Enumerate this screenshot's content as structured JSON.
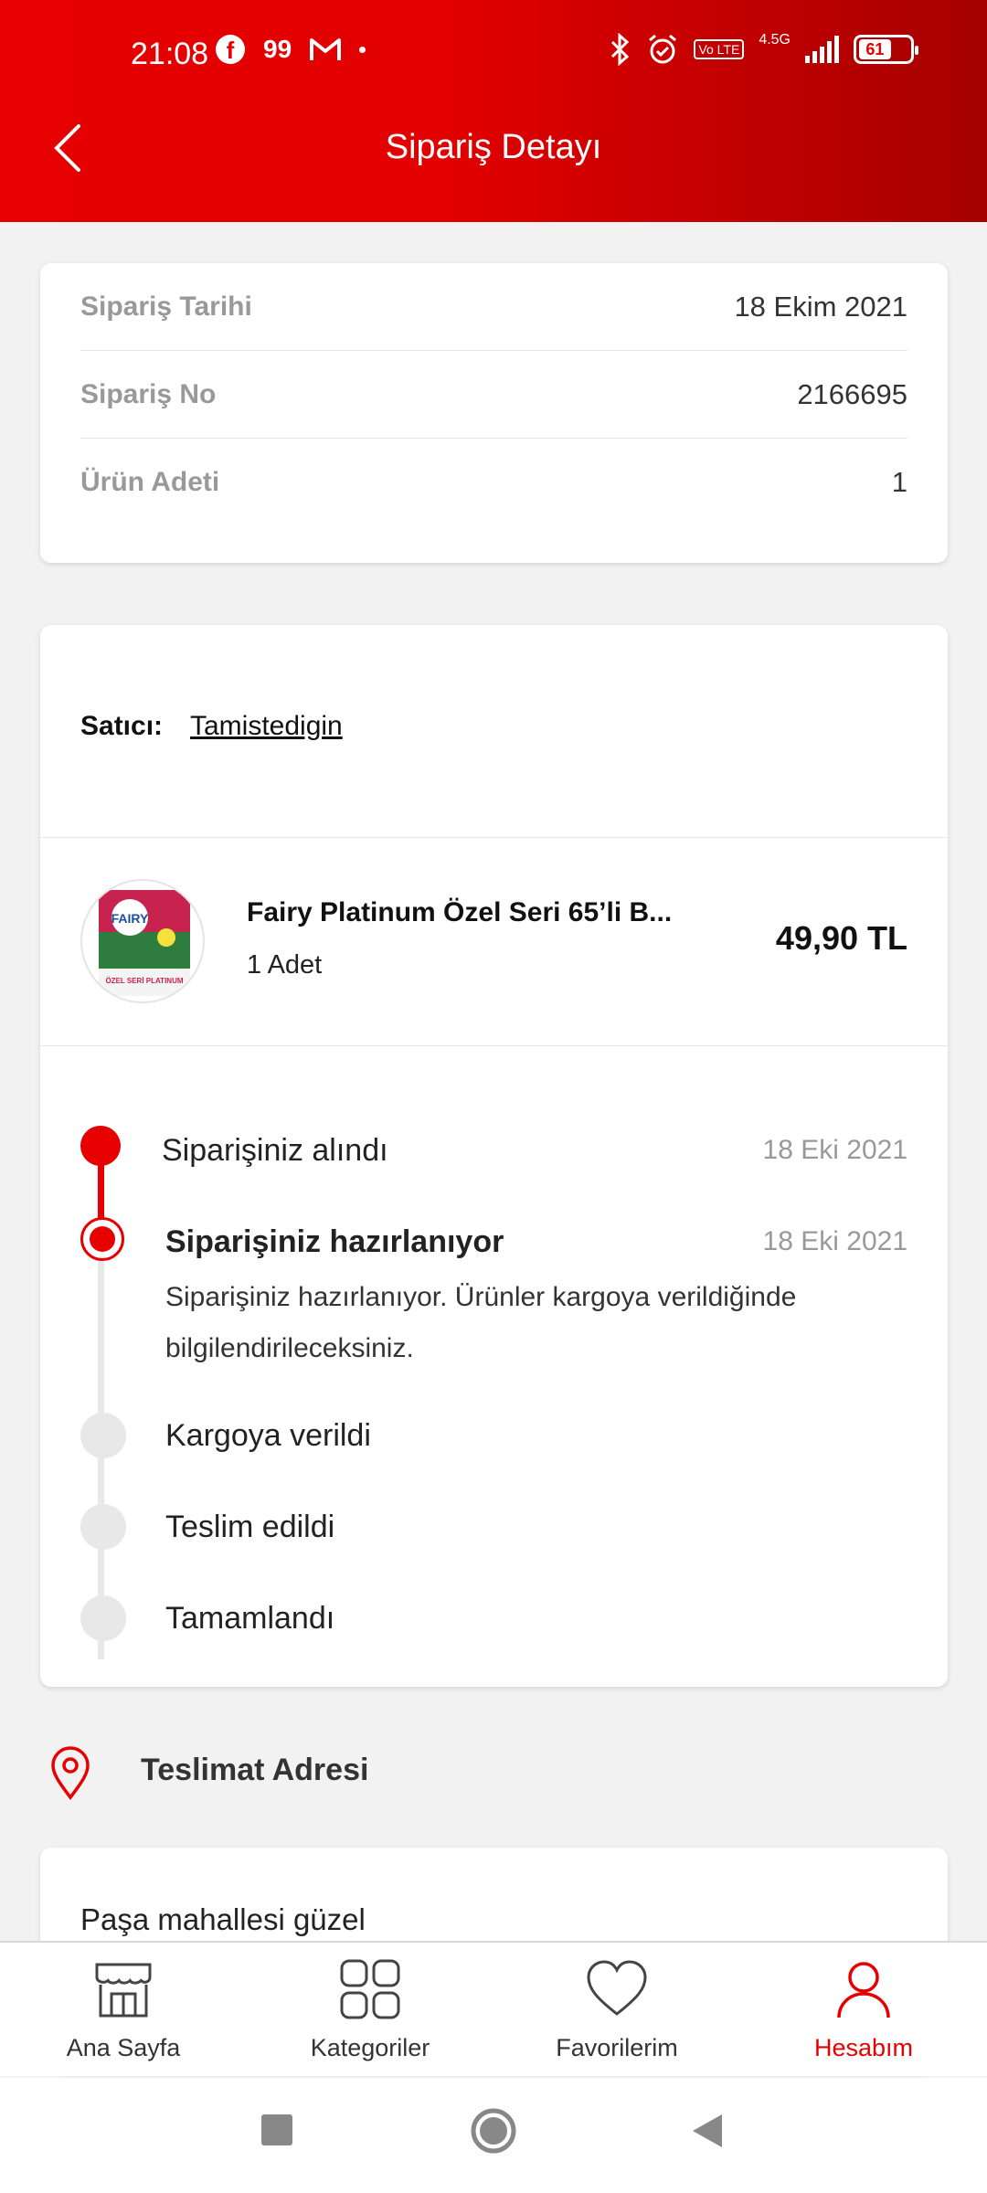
{
  "status_bar": {
    "time": "21:08",
    "network": "4.5G",
    "volte": "Vo LTE",
    "battery": "61",
    "notif_99": "99"
  },
  "header": {
    "title": "Sipariş Detayı"
  },
  "order_info": {
    "rows": [
      {
        "label": "Sipariş Tarihi",
        "value": "18 Ekim 2021"
      },
      {
        "label": "Sipariş No",
        "value": "2166695"
      },
      {
        "label": "Ürün Adeti",
        "value": "1"
      }
    ]
  },
  "seller": {
    "label": "Satıcı:",
    "name": "Tamistedigin"
  },
  "product": {
    "name": "Fairy Platinum Özel Seri 65’li B...",
    "quantity": "1 Adet",
    "price": "49,90 TL",
    "image_text_brand": "FAIRY",
    "image_text_line": "ÖZEL SERİ PLATINUM"
  },
  "timeline": {
    "steps": [
      {
        "title": "Siparişiniz alındı",
        "date": "18 Eki 2021",
        "state": "done"
      },
      {
        "title": "Siparişiniz hazırlanıyor",
        "date": "18 Eki 2021",
        "state": "current"
      },
      {
        "title": "Kargoya verildi",
        "date": "",
        "state": "pending"
      },
      {
        "title": "Teslim edildi",
        "date": "",
        "state": "pending"
      },
      {
        "title": "Tamamlandı",
        "date": "",
        "state": "pending"
      }
    ],
    "current_description": "Siparişiniz hazırlanıyor. Ürünler kargoya verildiğinde bilgilendirileceksiniz."
  },
  "address": {
    "title": "Teslimat Adresi",
    "line": "Paşa mahallesi güzel"
  },
  "bottom_nav": {
    "items": [
      {
        "label": "Ana Sayfa",
        "icon": "store-icon"
      },
      {
        "label": "Kategoriler",
        "icon": "grid-icon"
      },
      {
        "label": "Favorilerim",
        "icon": "heart-icon"
      },
      {
        "label": "Hesabım",
        "icon": "user-icon"
      }
    ],
    "active_index": 3
  },
  "colors": {
    "brand_red": "#e60000",
    "dark_red": "#a50000",
    "pending_gray": "#e8e8e8"
  }
}
